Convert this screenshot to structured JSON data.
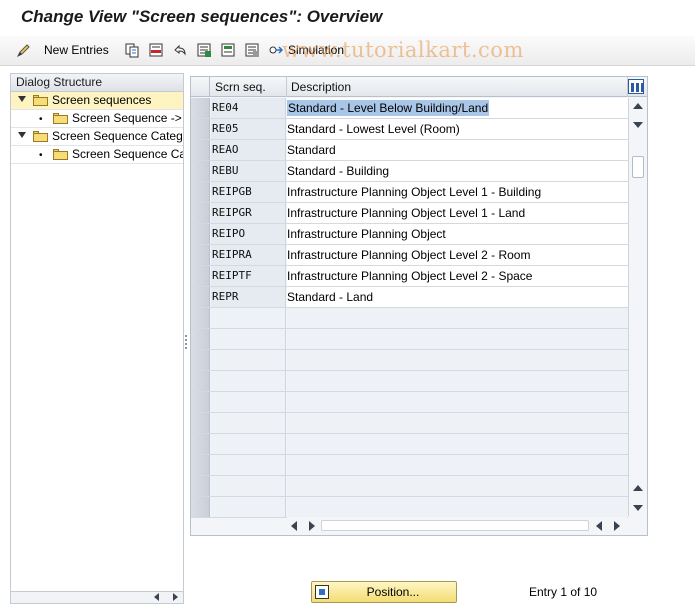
{
  "window": {
    "title": "Change View \"Screen sequences\": Overview"
  },
  "toolbar": {
    "new_entries_label": "New Entries",
    "simulation_label": "Simulation",
    "watermark": "www.tutorialkart.com"
  },
  "dialog_structure": {
    "header": "Dialog Structure",
    "items": [
      {
        "label": "Screen sequences"
      },
      {
        "label": "Screen Sequence ->"
      },
      {
        "label": "Screen Sequence Categ"
      },
      {
        "label": "Screen Sequence Ca"
      }
    ]
  },
  "table": {
    "columns": [
      "Scrn seq.",
      "Description"
    ],
    "rows": [
      {
        "key": "RE04",
        "desc": "Standard - Level Below Building/Land"
      },
      {
        "key": "RE05",
        "desc": "Standard - Lowest Level (Room)"
      },
      {
        "key": "REAO",
        "desc": "Standard"
      },
      {
        "key": "REBU",
        "desc": "Standard - Building"
      },
      {
        "key": "REIPGB",
        "desc": "Infrastructure Planning Object Level 1 - Building"
      },
      {
        "key": "REIPGR",
        "desc": "Infrastructure Planning Object Level 1 - Land"
      },
      {
        "key": "REIPO",
        "desc": "Infrastructure Planning Object"
      },
      {
        "key": "REIPRA",
        "desc": "Infrastructure Planning Object Level 2 - Room"
      },
      {
        "key": "REIPTF",
        "desc": "Infrastructure Planning Object Level 2 - Space"
      },
      {
        "key": "REPR",
        "desc": "Standard - Land"
      }
    ]
  },
  "footer": {
    "position_label": "Position...",
    "entry_info": "Entry 1 of 10"
  }
}
